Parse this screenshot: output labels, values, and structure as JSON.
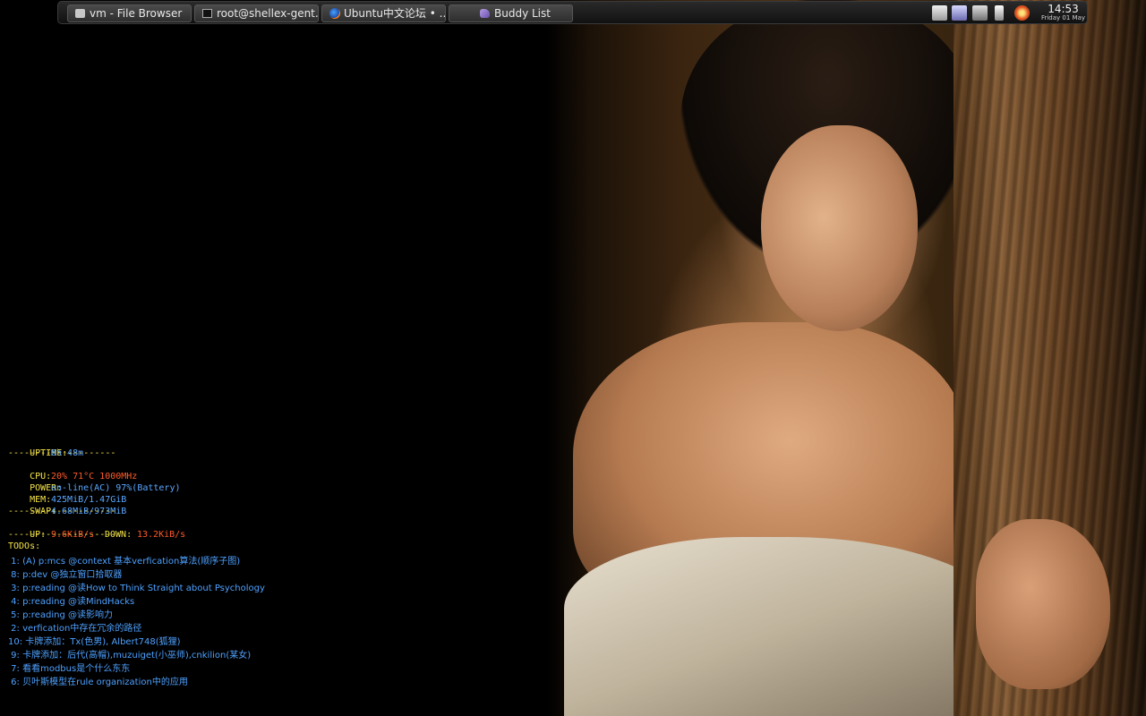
{
  "taskbar": {
    "tasks": [
      {
        "label": "vm - File Browser",
        "icon": "file-browser-icon"
      },
      {
        "label": "root@shellex-gent...",
        "icon": "terminal-icon"
      },
      {
        "label": "Ubuntu中文论坛 • ...",
        "icon": "firefox-icon"
      },
      {
        "label": "Buddy List",
        "icon": "pidgin-icon"
      }
    ],
    "tray_icons": [
      "network-icon",
      "display-icon",
      "keyboard-icon",
      "battery-icon",
      "update-icon"
    ],
    "clock": {
      "time": "14:53",
      "date": "Friday 01 May"
    }
  },
  "conky": {
    "uptime_label": "UPTIME:",
    "uptime_value": "8h 48m",
    "separator": "--------------------",
    "cpu_label": "CPU:",
    "cpu_value": "20% 71°C 1000MHz",
    "power_label": "POWER:",
    "power_value": "on-line(AC) 97%(Battery)",
    "mem_label": "MEM:",
    "mem_value": "425MiB/1.47GiB",
    "swap_label": "SWAP:",
    "swap_value": "4.68MiB/973MiB",
    "up_label": "UP:",
    "up_value": "9.6KiB/s",
    "down_label": "DOWN:",
    "down_value": "13.2KiB/s",
    "todos_label": "TODOs:",
    "todos": [
      " 1: (A) p:mcs @context 基本verfication算法(顺序子图)",
      " 8: p:dev @独立窗口拾取器",
      " 3: p:reading @读How to Think Straight about Psychology",
      " 4: p:reading @读MindHacks",
      " 5: p:reading @读影响力",
      " 2: verfication中存在冗余的路径",
      "10: 卡牌添加：Tx(色男), Albert748(狐狸)",
      " 9: 卡牌添加：后代(高帽),muzuiget(小巫师),cnkilion(某女)",
      " 7: 看看modbus是个什么东东",
      " 6: 贝叶斯模型在rule organization中的应用"
    ]
  },
  "colors": {
    "label": "#f5e44a",
    "value": "#5aa7ff",
    "alert": "#ff5a2a",
    "todo": "#4ea1ff"
  }
}
